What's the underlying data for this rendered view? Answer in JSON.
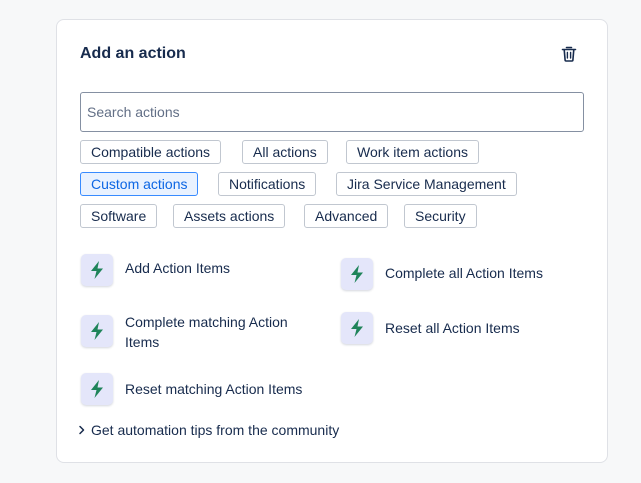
{
  "panel": {
    "title": "Add an action",
    "delete_icon": "trash-icon"
  },
  "search": {
    "placeholder": "Search actions",
    "value": ""
  },
  "filters": [
    {
      "label": "Compatible actions",
      "selected": false
    },
    {
      "label": "All actions",
      "selected": false
    },
    {
      "label": "Work item actions",
      "selected": false
    },
    {
      "label": "Custom actions",
      "selected": true
    },
    {
      "label": "Notifications",
      "selected": false
    },
    {
      "label": "Jira Service Management",
      "selected": false
    },
    {
      "label": "Software",
      "selected": false
    },
    {
      "label": "Assets actions",
      "selected": false
    },
    {
      "label": "Advanced",
      "selected": false
    },
    {
      "label": "Security",
      "selected": false
    }
  ],
  "actions": [
    {
      "label": "Add Action Items",
      "icon": "lightning-bolt-icon"
    },
    {
      "label": "Complete all Action Items",
      "icon": "lightning-bolt-icon"
    },
    {
      "label": "Complete matching Action Items",
      "icon": "lightning-bolt-icon"
    },
    {
      "label": "Reset all Action Items",
      "icon": "lightning-bolt-icon"
    },
    {
      "label": "Reset matching Action Items",
      "icon": "lightning-bolt-icon"
    }
  ],
  "tips": {
    "label": "Get automation tips from the community",
    "icon": "chevron-right-icon"
  },
  "colors": {
    "accent": "#0c66e4",
    "selected_bg": "#e9f2ff",
    "icon_bg": "#e4e6fa",
    "bolt": "#1f845a"
  }
}
